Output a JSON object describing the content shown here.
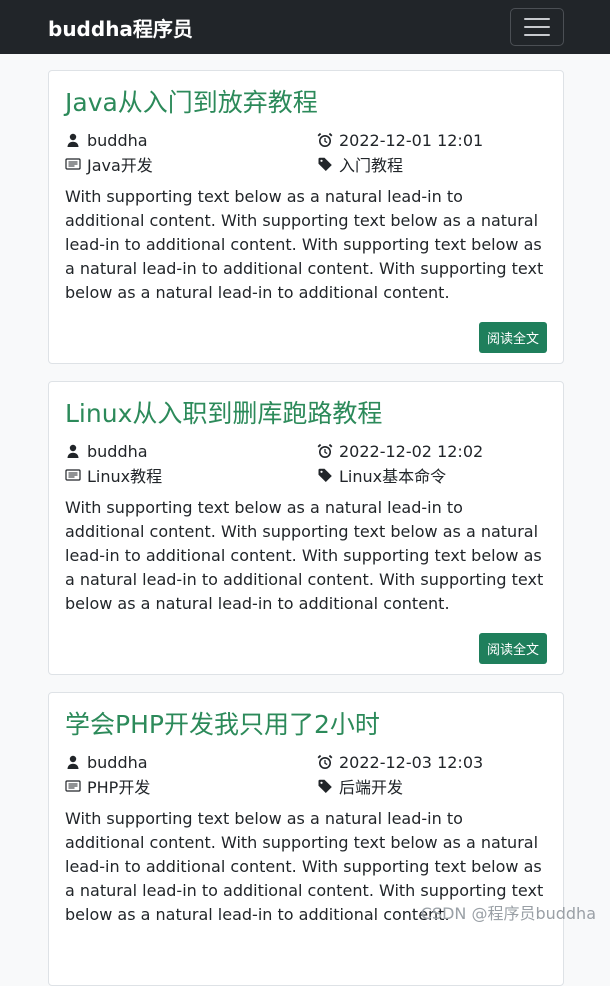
{
  "navbar": {
    "brand": "buddha程序员"
  },
  "posts": [
    {
      "title": "Java从入门到放弃教程",
      "author": "buddha",
      "datetime": "2022-12-01 12:01",
      "category": "Java开发",
      "tag": "入门教程",
      "excerpt": "With supporting text below as a natural lead-in to additional content. With supporting text below as a natural lead-in to additional content. With supporting text below as a natural lead-in to additional content. With supporting text below as a natural lead-in to additional content.",
      "button": "阅读全文"
    },
    {
      "title": "Linux从入职到删库跑路教程",
      "author": "buddha",
      "datetime": "2022-12-02 12:02",
      "category": "Linux教程",
      "tag": "Linux基本命令",
      "excerpt": "With supporting text below as a natural lead-in to additional content. With supporting text below as a natural lead-in to additional content. With supporting text below as a natural lead-in to additional content. With supporting text below as a natural lead-in to additional content.",
      "button": "阅读全文"
    },
    {
      "title": "学会PHP开发我只用了2小时",
      "author": "buddha",
      "datetime": "2022-12-03 12:03",
      "category": "PHP开发",
      "tag": "后端开发",
      "excerpt": "With supporting text below as a natural lead-in to additional content. With supporting text below as a natural lead-in to additional content. With supporting text below as a natural lead-in to additional content. With supporting text below as a natural lead-in to additional content."
    }
  ],
  "watermark": "CSDN @程序员buddha",
  "colors": {
    "navbar": "#212529",
    "title": "#2c8a5a",
    "button": "#1f7f5c"
  }
}
